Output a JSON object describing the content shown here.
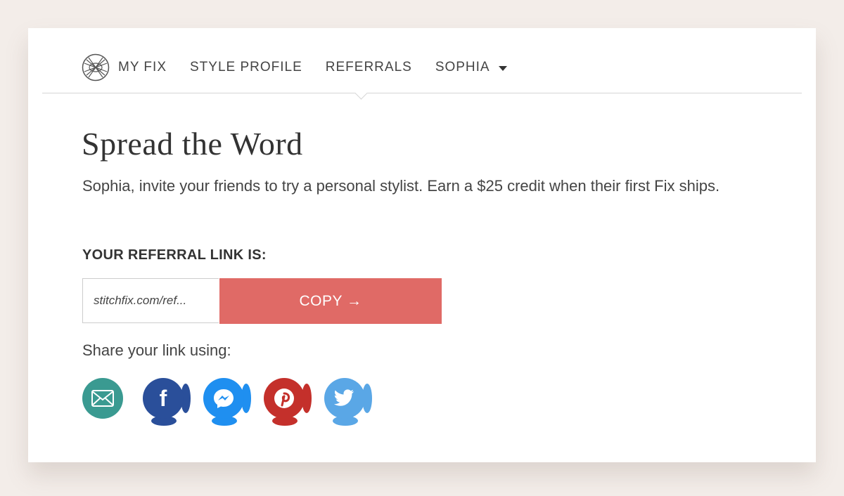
{
  "nav": {
    "logo_icon": "stitchfix-logo-icon",
    "items": [
      {
        "label": "MY FIX"
      },
      {
        "label": "STYLE PROFILE"
      },
      {
        "label": "REFERRALS",
        "active": true
      },
      {
        "label": "SOPHIA"
      }
    ]
  },
  "page": {
    "title": "Spread the Word",
    "description": "Sophia, invite your friends to try a personal stylist. Earn a $25 credit when their first Fix ships.",
    "referral_label": "YOUR REFERRAL LINK IS:",
    "referral_link": "stitchfix.com/ref...",
    "copy_label": "COPY →",
    "share_label": "Share your link using:"
  },
  "share": [
    {
      "name": "email",
      "icon": "mail-icon",
      "color": "#3a9a91"
    },
    {
      "name": "facebook",
      "icon": "facebook-icon",
      "color": "#2a4f9a"
    },
    {
      "name": "messenger",
      "icon": "messenger-icon",
      "color": "#1f8ff0"
    },
    {
      "name": "pinterest",
      "icon": "pinterest-icon",
      "color": "#c4302b"
    },
    {
      "name": "twitter",
      "icon": "twitter-icon",
      "color": "#5aa7e6"
    }
  ],
  "colors": {
    "copy_button": "#e06a66",
    "background": "#f3ede9"
  }
}
